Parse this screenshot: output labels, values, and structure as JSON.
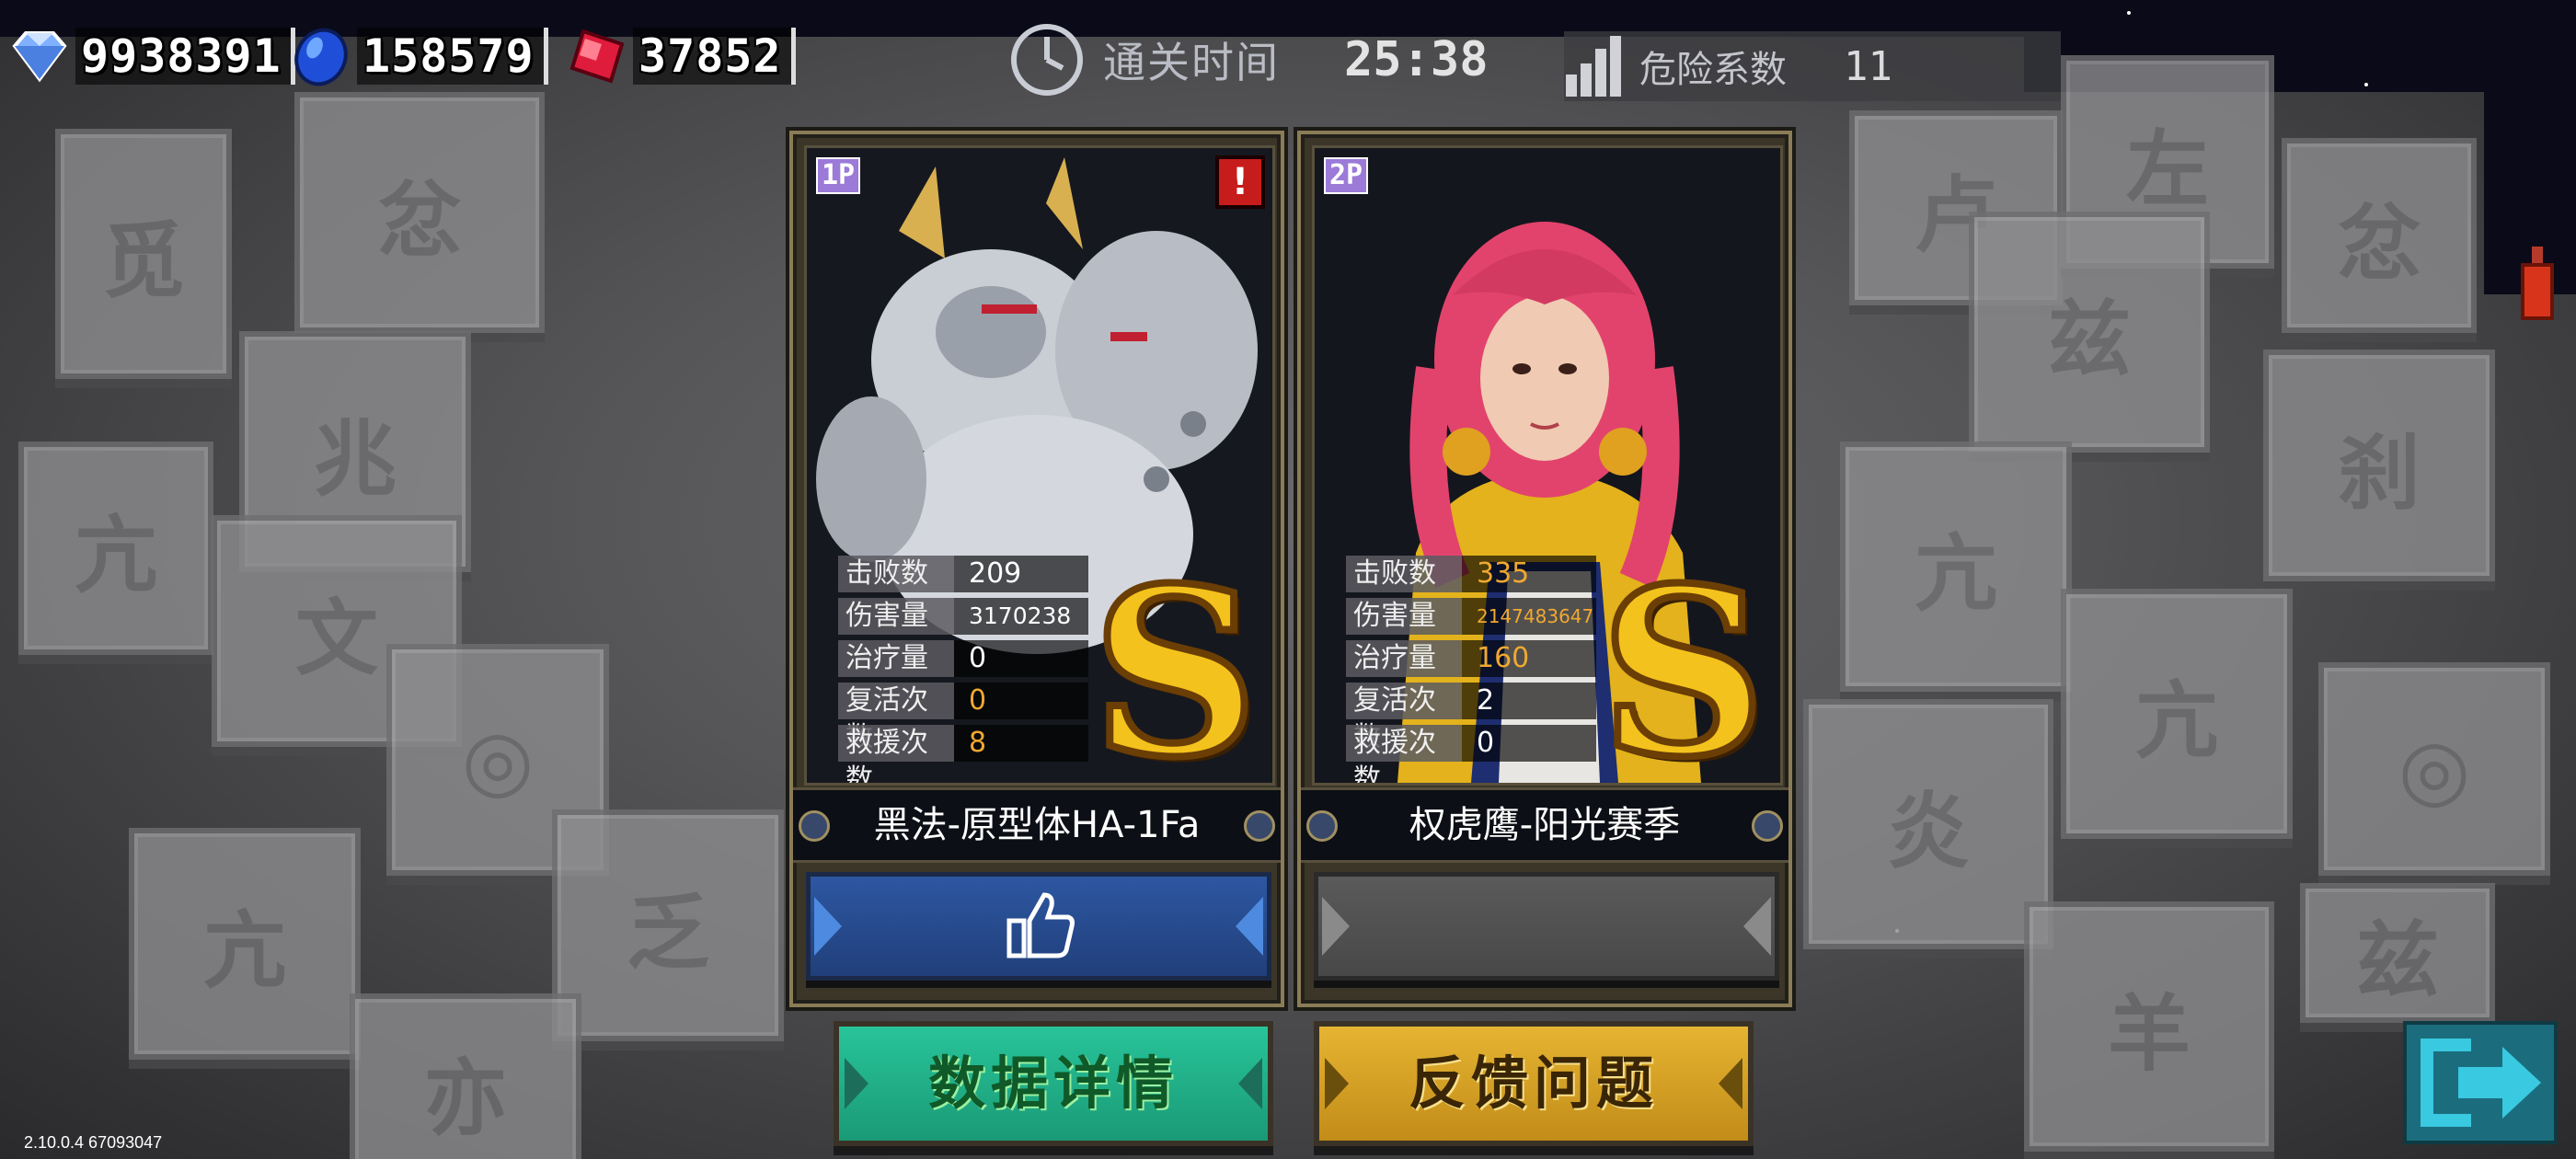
{
  "currency": {
    "diamonds": "9938391",
    "blue_gems": "158579",
    "red_gems": "37852"
  },
  "timer": {
    "label": "通关时间",
    "value": "25:38"
  },
  "danger": {
    "label": "危险系数",
    "value": "11"
  },
  "players": [
    {
      "tag": "1P",
      "name": "黑法-原型体HA-1Fa",
      "grade": "S",
      "warning": "!",
      "stats": [
        {
          "label": "击败数",
          "value": "209"
        },
        {
          "label": "伤害量",
          "value": "3170238"
        },
        {
          "label": "治疗量",
          "value": "0"
        },
        {
          "label": "复活次数",
          "value": "0"
        },
        {
          "label": "救援次数",
          "value": "8"
        }
      ]
    },
    {
      "tag": "2P",
      "name": "权虎鹰-阳光赛季",
      "grade": "S",
      "stats": [
        {
          "label": "击败数",
          "value": "335"
        },
        {
          "label": "伤害量",
          "value": "2147483647"
        },
        {
          "label": "治疗量",
          "value": "160"
        },
        {
          "label": "复活次数",
          "value": "2"
        },
        {
          "label": "救援次数",
          "value": "0"
        }
      ]
    }
  ],
  "buttons": {
    "data_details": "数据详情",
    "feedback": "反馈问题"
  },
  "version": "2.10.0.4 67093047",
  "colors": {
    "grade_gold": "#f4c21c",
    "like_blue": "#2d57a2",
    "data_green": "#28c49a",
    "feedback_yellow": "#e6b432",
    "highlight_orange": "#f0a830"
  },
  "icons": [
    "diamond-icon",
    "blue-gem-icon",
    "red-gem-icon",
    "clock-icon",
    "danger-bars-icon",
    "thumbs-up-icon",
    "exit-icon",
    "potion-icon"
  ]
}
